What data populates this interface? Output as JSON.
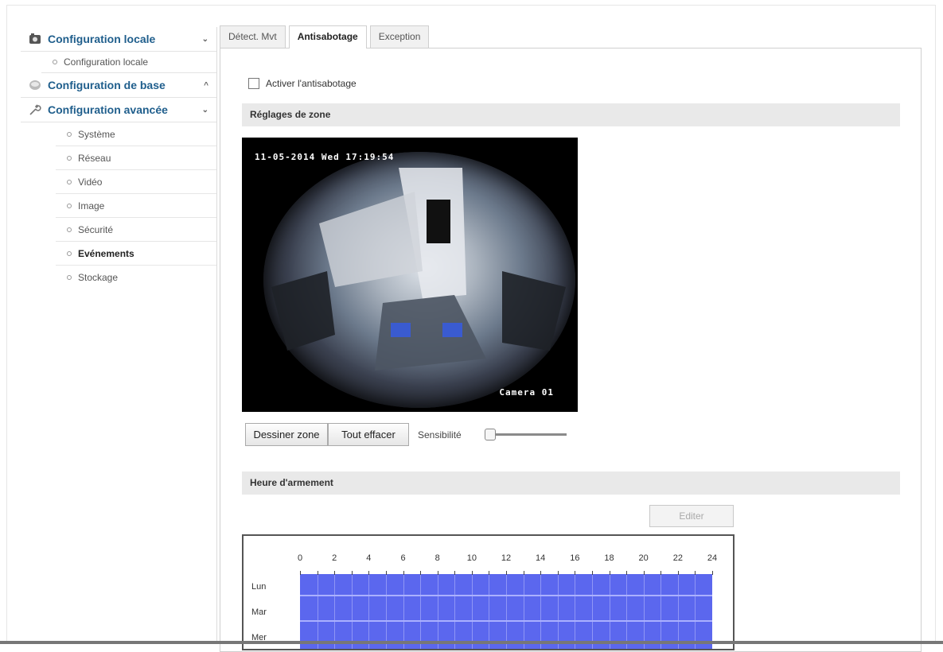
{
  "sidebar": {
    "sections": [
      {
        "label": "Configuration locale",
        "icon": "camera-icon",
        "chevron": "⌄"
      },
      {
        "label": "Configuration de base",
        "icon": "disk-icon",
        "chevron": "^"
      },
      {
        "label": "Configuration avancée",
        "icon": "wrench-icon",
        "chevron": "⌄"
      }
    ],
    "local_items": [
      "Configuration locale"
    ],
    "advanced_items": [
      "Système",
      "Réseau",
      "Vidéo",
      "Image",
      "Sécurité",
      "Evénements",
      "Stockage"
    ],
    "active_item": "Evénements"
  },
  "tabs": [
    "Détect. Mvt",
    "Antisabotage",
    "Exception"
  ],
  "active_tab": "Antisabotage",
  "enable_label": "Activer l'antisabotage",
  "zone_section": "Réglages de zone",
  "camera": {
    "osd_datetime": "11-05-2014 Wed 17:19:54",
    "osd_name": "Camera 01"
  },
  "buttons": {
    "draw_zone": "Dessiner zone",
    "clear_all": "Tout effacer",
    "edit": "Editer"
  },
  "sensitivity_label": "Sensibilité",
  "sensitivity_value": 0,
  "schedule_section": "Heure d'armement",
  "schedule": {
    "hours": [
      "0",
      "2",
      "4",
      "6",
      "8",
      "10",
      "12",
      "14",
      "16",
      "18",
      "20",
      "22",
      "24"
    ],
    "days": [
      "Lun",
      "Mar",
      "Mer"
    ],
    "fill_color": "#5b67ee"
  }
}
